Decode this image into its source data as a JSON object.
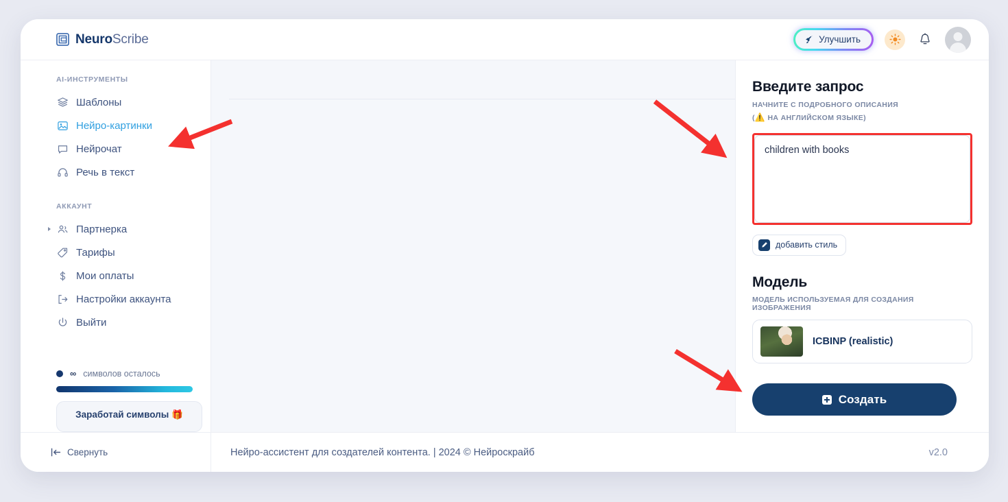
{
  "brand": {
    "bold": "Neuro",
    "light": "Scribe",
    "logo_icon": "nested-square-logo-icon"
  },
  "header": {
    "improve_label": "Улучшить",
    "improve_icon": "rocket-icon",
    "theme_icon": "sun-icon",
    "bell_icon": "bell-icon",
    "avatar_icon": "user-avatar"
  },
  "sidebar": {
    "section_tools": "AI-ИНСТРУМЕНТЫ",
    "section_account": "АККАУНТ",
    "tools": [
      {
        "label": "Шаблоны",
        "icon": "layers-icon",
        "active": false
      },
      {
        "label": "Нейро-картинки",
        "icon": "image-icon",
        "active": true
      },
      {
        "label": "Нейрочат",
        "icon": "chat-bubble-icon",
        "active": false
      },
      {
        "label": "Речь в текст",
        "icon": "headphones-icon",
        "active": false
      }
    ],
    "account": [
      {
        "label": "Партнерка",
        "icon": "users-icon",
        "expandable": true
      },
      {
        "label": "Тарифы",
        "icon": "tag-icon",
        "expandable": false
      },
      {
        "label": "Мои оплаты",
        "icon": "dollar-icon",
        "expandable": false
      },
      {
        "label": "Настройки аккаунта",
        "icon": "logout-arrow-icon",
        "expandable": false
      },
      {
        "label": "Выйти",
        "icon": "power-icon",
        "expandable": false
      }
    ],
    "credits_value": "∞",
    "credits_label": "символов осталось",
    "earn_label": "Заработай символы 🎁",
    "progress_percent": 100
  },
  "right_panel": {
    "prompt_title": "Введите запрос",
    "prompt_subtitle_line1": "НАЧНИТЕ С ПОДРОБНОГО ОПИСАНИЯ",
    "prompt_subtitle_line2": "НА АНГЛИЙСКОМ ЯЗЫКЕ)",
    "prompt_value": "children with books",
    "prompt_placeholder": "",
    "style_button_label": "добавить стиль",
    "style_button_icon": "pencil-icon",
    "model_title": "Модель",
    "model_subtitle": "МОДЕЛЬ ИСПОЛЬЗУЕМАЯ ДЛЯ СОЗДАНИЯ ИЗОБРАЖЕНИЯ",
    "model_selected": "ICBINP (realistic)",
    "create_label": "Создать",
    "create_icon": "plus-icon"
  },
  "footer": {
    "collapse_label": "Свернуть",
    "collapse_icon": "collapse-left-icon",
    "tagline": "Нейро-ассистент для создателей контента.  | 2024 © Нейроскрайб",
    "version": "v2.0"
  },
  "annotations": {
    "arrow_color": "#f4312f",
    "highlight_color": "#f4312f"
  }
}
